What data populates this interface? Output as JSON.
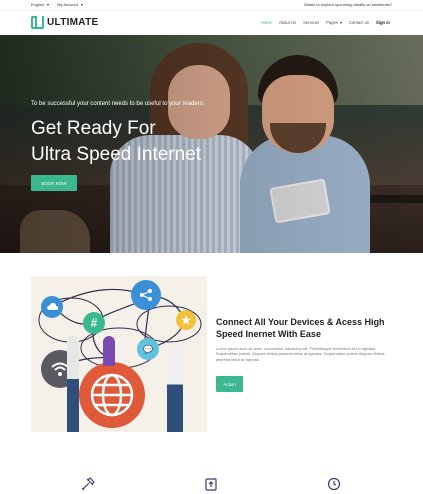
{
  "topbar": {
    "language": "English",
    "account": "My Account",
    "announcement": "Wants to explore upcoming details on weekends?"
  },
  "brand": {
    "name": "ULTIMATE",
    "accent_color": "#3bb88f"
  },
  "nav": {
    "items": [
      {
        "label": "Home",
        "active": true
      },
      {
        "label": "About Us"
      },
      {
        "label": "Services"
      },
      {
        "label": "Pages",
        "dropdown": true
      },
      {
        "label": "Contact us"
      },
      {
        "label": "Sign in"
      }
    ]
  },
  "hero": {
    "subtitle": "To be successful your content needs to be useful to your readers.",
    "title_line1": "Get Ready For",
    "title_line2": "Ultra Speed Internet",
    "button_label": "BOOK NOW"
  },
  "feature": {
    "title": "Connect All Your Devices & Acess High Speed Inernet With Ease",
    "body": "Lorem ipsum dolor sit amet, consectetur adipiscing elit. Pellentesque fermentum est in egestas. Suspendisse potenti. Aliquam finibus pharetra tellus at egestas. Suspendisse potenti.Aliquam finibus pharetra tellus at egestas.",
    "button_label": "Action",
    "illustration_icons": [
      "cloud-icon",
      "share-icon",
      "hashtag-icon",
      "star-icon",
      "chat-icon",
      "wifi-icon",
      "globe-icon"
    ]
  },
  "bottom_icons": [
    "tools-icon",
    "upload-icon",
    "clock-icon"
  ]
}
